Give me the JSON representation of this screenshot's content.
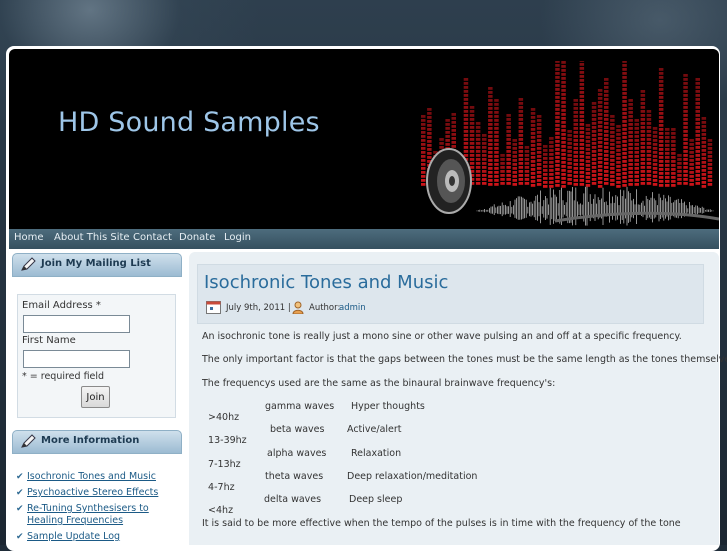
{
  "site": {
    "title": "HD Sound Samples"
  },
  "nav": {
    "items": [
      "Home",
      "About This Site",
      "Contact",
      "Donate",
      "Login"
    ]
  },
  "mailing": {
    "heading": "Join My Mailing List",
    "email_label": "Email Address *",
    "name_label": "First Name",
    "required_note": "* = required field",
    "join_label": "Join"
  },
  "more_info": {
    "heading": "More Information",
    "links": [
      [
        "Isochronic Tones and Music"
      ],
      [
        "Psychoactive Stereo Effects"
      ],
      [
        "Re-Tuning Synthesisers to",
        "Healing Frequencies"
      ],
      [
        "Sample Update Log"
      ]
    ]
  },
  "post": {
    "title": "Isochronic Tones and Music",
    "date": "July 9th, 2011 |",
    "author_label": "Author:",
    "author": "admin",
    "p1": "An isochronic tone is really just a mono sine or other wave pulsing an and off at a specific frequency.",
    "p2": "The only important factor is that the gaps between the tones must be the same length as the tones themselves.",
    "p3": "The frequencys used are the same as the binaural brainwave frequency's:",
    "table": [
      [
        ">40hz",
        "gamma waves",
        "Hyper thoughts"
      ],
      [
        "13-39hz",
        "beta waves",
        "Active/alert"
      ],
      [
        "7-13hz",
        "alpha waves",
        "Relaxation"
      ],
      [
        "4-7hz",
        "theta waves",
        "Deep relaxation/meditation"
      ],
      [
        "<4hz",
        "delta waves",
        "Deep sleep"
      ]
    ],
    "p4": "It is said to be more effective when the tempo of the pulses is in time with the frequency of the tone"
  },
  "colors": {
    "accent": "#2a6c9c",
    "nav_bg": "#3f5b6b",
    "header_bg": "#000000",
    "eq_red": "#d0141a"
  }
}
